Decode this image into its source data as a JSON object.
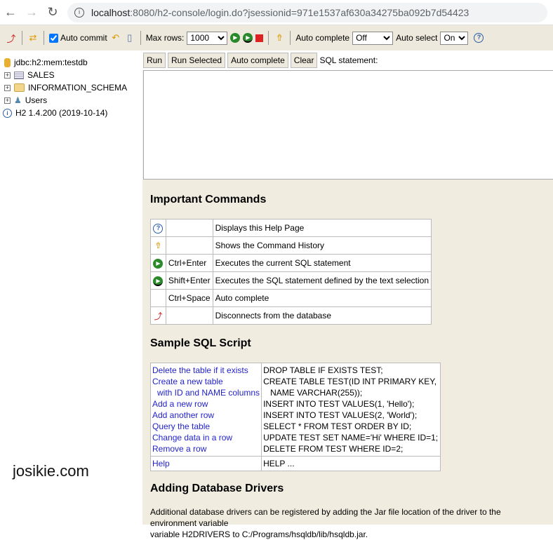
{
  "browser": {
    "url_host": "localhost",
    "url_path": ":8080/h2-console/login.do?jsessionid=971e1537af630a34275ba092b7d54423"
  },
  "toolbar": {
    "auto_commit": "Auto commit",
    "auto_commit_checked": true,
    "max_rows_label": "Max rows:",
    "max_rows": "1000",
    "auto_complete_label": "Auto complete",
    "auto_complete": "Off",
    "auto_select_label": "Auto select",
    "auto_select": "On"
  },
  "tree": {
    "connection": "jdbc:h2:mem:testdb",
    "items": [
      "SALES",
      "INFORMATION_SCHEMA",
      "Users"
    ],
    "version": "H2 1.4.200 (2019-10-14)"
  },
  "editor": {
    "run": "Run",
    "run_selected": "Run Selected",
    "auto_complete": "Auto complete",
    "clear": "Clear",
    "label": "SQL statement:"
  },
  "help": {
    "important_title": "Important Commands",
    "commands": [
      {
        "icon": "help-icon",
        "key": "",
        "desc": "Displays this Help Page"
      },
      {
        "icon": "history-icon",
        "key": "",
        "desc": "Shows the Command History"
      },
      {
        "icon": "run-icon",
        "key": "Ctrl+Enter",
        "desc": "Executes the current SQL statement"
      },
      {
        "icon": "run-selected-icon",
        "key": "Shift+Enter",
        "desc": "Executes the SQL statement defined by the text selection"
      },
      {
        "icon": "",
        "key": "Ctrl+Space",
        "desc": "Auto complete"
      },
      {
        "icon": "disconnect-icon",
        "key": "",
        "desc": "Disconnects from the database"
      }
    ],
    "sample_title": "Sample SQL Script",
    "sample": [
      {
        "link": "Delete the table if it exists",
        "sql": "DROP TABLE IF EXISTS TEST;"
      },
      {
        "link": "Create a new table",
        "sql": "CREATE TABLE TEST(ID INT PRIMARY KEY,"
      },
      {
        "link": "with ID and NAME columns",
        "sql": "NAME VARCHAR(255));"
      },
      {
        "link": "Add a new row",
        "sql": "INSERT INTO TEST VALUES(1, 'Hello');"
      },
      {
        "link": "Add another row",
        "sql": "INSERT INTO TEST VALUES(2, 'World');"
      },
      {
        "link": "Query the table",
        "sql": "SELECT * FROM TEST ORDER BY ID;"
      },
      {
        "link": "Change data in a row",
        "sql": "UPDATE TEST SET NAME='Hi' WHERE ID=1;"
      },
      {
        "link": "Remove a row",
        "sql": "DELETE FROM TEST WHERE ID=2;"
      }
    ],
    "help_link": "Help",
    "help_sql": "HELP ...",
    "drivers_title": "Adding Database Drivers",
    "drivers_text1": "Additional database drivers can be registered by adding the Jar file location of the driver to the environment variable",
    "drivers_text2": "variable H2DRIVERS to C:/Programs/hsqldb/lib/hsqldb.jar."
  },
  "watermark": "josikie.com"
}
